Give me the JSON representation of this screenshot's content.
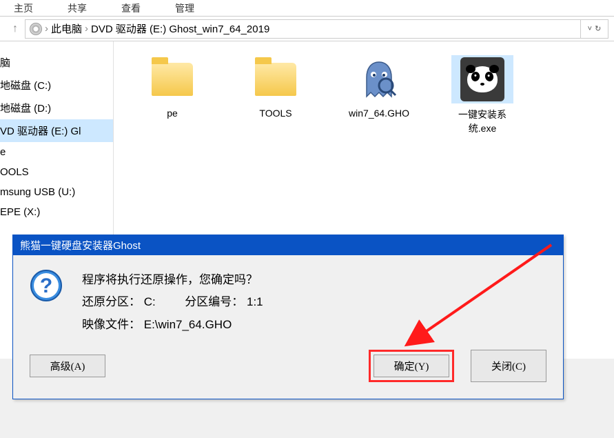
{
  "ribbon": {
    "tab1": "主页",
    "tab2": "共享",
    "tab3": "查看",
    "tab4": "管理"
  },
  "breadcrumb": {
    "root": "此电脑",
    "drive": "DVD 驱动器 (E:) Ghost_win7_64_2019"
  },
  "sidebar": {
    "items": [
      {
        "label": "脑"
      },
      {
        "label": "地磁盘 (C:)"
      },
      {
        "label": "地磁盘 (D:)"
      },
      {
        "label": "VD 驱动器 (E:) Gl"
      },
      {
        "label": "e"
      },
      {
        "label": "OOLS"
      },
      {
        "label": "msung USB (U:)"
      },
      {
        "label": "EPE (X:)"
      }
    ],
    "selected_index": 3
  },
  "files": {
    "items": [
      {
        "name": "pe",
        "type": "folder"
      },
      {
        "name": "TOOLS",
        "type": "folder"
      },
      {
        "name": "win7_64.GHO",
        "type": "gho"
      },
      {
        "name": "一键安装系统.exe",
        "type": "panda"
      }
    ],
    "selected_index": 3
  },
  "dialog": {
    "title": "熊猫一键硬盘安装器Ghost",
    "line1": "程序将执行还原操作，您确定吗？",
    "line2_label": "还原分区：",
    "line2_value": "C:",
    "line2b_label": "分区编号：",
    "line2b_value": "1:1",
    "line3_label": "映像文件：",
    "line3_value": "E:\\win7_64.GHO",
    "btn_advanced": "高级(A)",
    "btn_ok": "确定(Y)",
    "btn_close": "关闭(C)"
  }
}
